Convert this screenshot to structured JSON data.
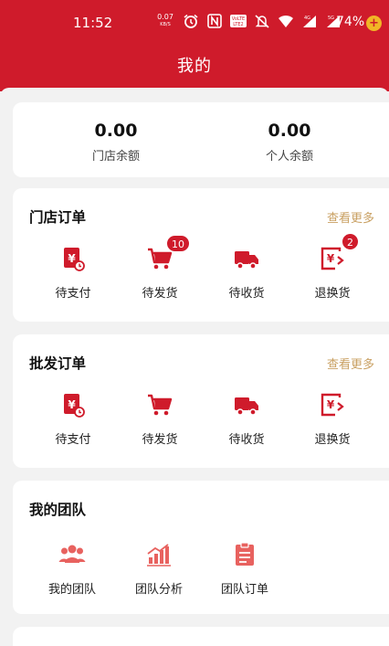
{
  "status_bar": {
    "time": "11:52",
    "net_speed_value": "0.07",
    "net_speed_unit": "KB/S",
    "battery": "74%",
    "icons": [
      "alarm-icon",
      "nfc-icon",
      "volte-icon",
      "mute-icon",
      "wifi-icon",
      "signal-4g-icon",
      "signal-5g-icon"
    ]
  },
  "header": {
    "title": "我的",
    "color": "#cf1b2b"
  },
  "balances": {
    "store": {
      "value": "0.00",
      "label": "门店余额"
    },
    "personal": {
      "value": "0.00",
      "label": "个人余额"
    }
  },
  "store_orders": {
    "title": "门店订单",
    "more": "查看更多",
    "items": [
      {
        "label": "待支付",
        "icon": "yuan-bill-icon",
        "badge": ""
      },
      {
        "label": "待发货",
        "icon": "cart-icon",
        "badge": "10"
      },
      {
        "label": "待收货",
        "icon": "truck-icon",
        "badge": ""
      },
      {
        "label": "退换货",
        "icon": "return-icon",
        "badge": "2"
      }
    ]
  },
  "wholesale_orders": {
    "title": "批发订单",
    "more": "查看更多",
    "items": [
      {
        "label": "待支付",
        "icon": "yuan-bill-icon"
      },
      {
        "label": "待发货",
        "icon": "cart-icon"
      },
      {
        "label": "待收货",
        "icon": "truck-icon"
      },
      {
        "label": "退换货",
        "icon": "return-icon"
      }
    ]
  },
  "team": {
    "title": "我的团队",
    "items": [
      {
        "label": "我的团队",
        "icon": "team-icon"
      },
      {
        "label": "团队分析",
        "icon": "chart-icon"
      },
      {
        "label": "团队订单",
        "icon": "clipboard-icon"
      }
    ]
  },
  "colors": {
    "accent": "#cf1b2b",
    "more_link": "#c9a062",
    "icon_light": "#e8625f"
  }
}
